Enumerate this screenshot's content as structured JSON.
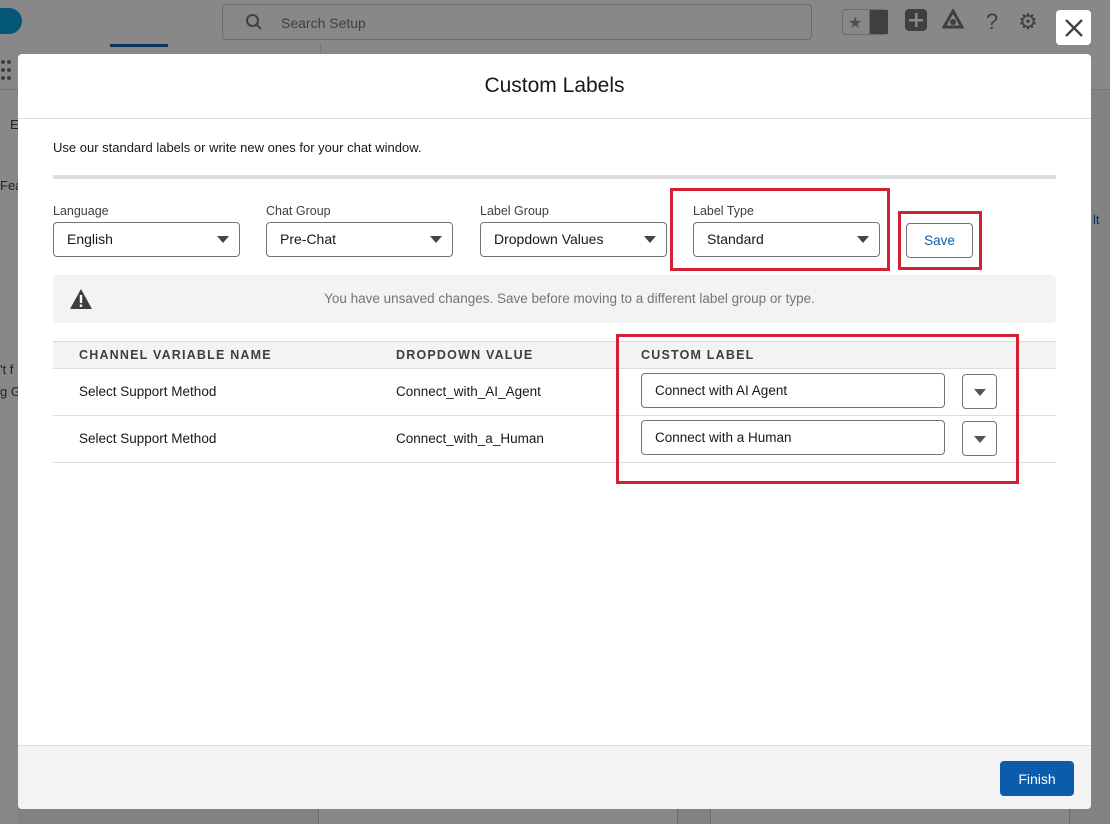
{
  "background": {
    "search_placeholder": "Search Setup",
    "snippets": [
      "E",
      "Fea",
      "'t f",
      "g G",
      "lt"
    ]
  },
  "modal": {
    "title": "Custom Labels",
    "intro": "Use our standard labels or write new ones for your chat window.",
    "fields": [
      {
        "label": "Language",
        "value": "English"
      },
      {
        "label": "Chat Group",
        "value": "Pre-Chat"
      },
      {
        "label": "Label Group",
        "value": "Dropdown Values"
      },
      {
        "label": "Label Type",
        "value": "Standard"
      }
    ],
    "save_label": "Save",
    "alert_text": "You have unsaved changes. Save before moving to a different label group or type.",
    "table": {
      "headers": [
        "CHANNEL VARIABLE NAME",
        "DROPDOWN VALUE",
        "CUSTOM LABEL"
      ],
      "rows": [
        {
          "variable": "Select Support Method",
          "dropdown": "Connect_with_AI_Agent",
          "custom_label": "Connect with AI Agent"
        },
        {
          "variable": "Select Support Method",
          "dropdown": "Connect_with_a_Human",
          "custom_label": "Connect with a Human"
        }
      ]
    },
    "finish_label": "Finish"
  },
  "colors": {
    "brand_button": "#0b5cab",
    "highlight": "#d22232",
    "overlay": "#080707"
  }
}
